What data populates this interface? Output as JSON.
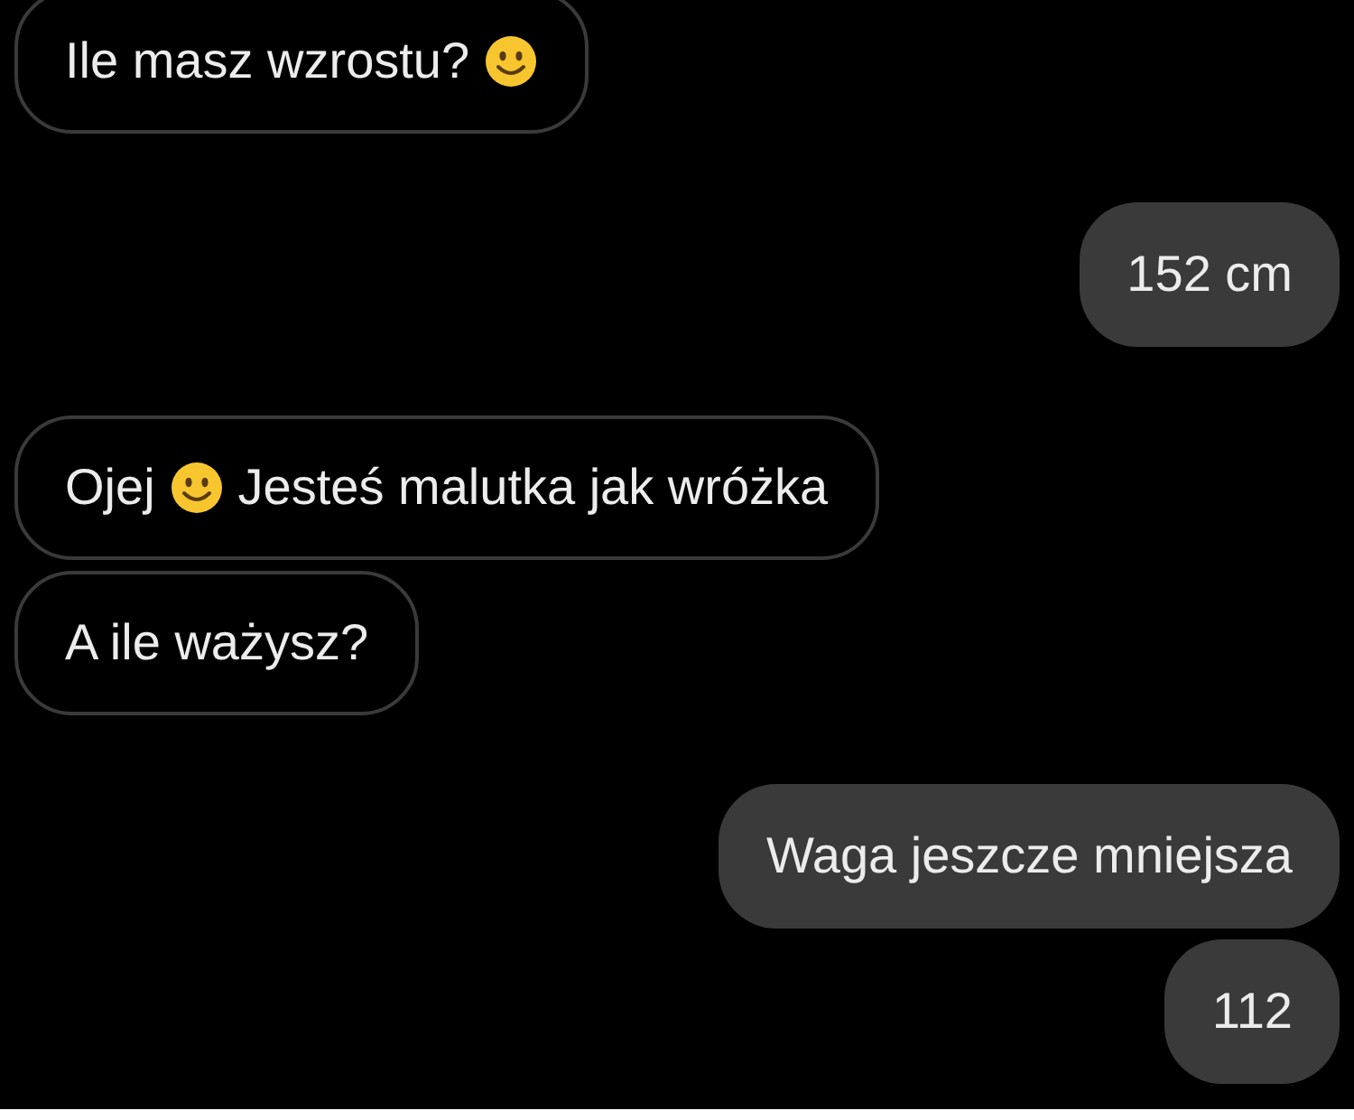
{
  "groups": [
    {
      "kind": "incoming",
      "messages": [
        {
          "parts": [
            {
              "kind": "text",
              "text": "Ile masz wzrostu?"
            },
            {
              "kind": "emoji"
            }
          ]
        }
      ]
    },
    {
      "kind": "outgoing",
      "messages": [
        {
          "parts": [
            {
              "kind": "text",
              "text": "152 cm"
            }
          ]
        }
      ]
    },
    {
      "kind": "incoming",
      "messages": [
        {
          "parts": [
            {
              "kind": "text",
              "text": "Ojej"
            },
            {
              "kind": "emoji"
            },
            {
              "kind": "text",
              "text": "Jesteś malutka jak wróżka"
            }
          ]
        },
        {
          "parts": [
            {
              "kind": "text",
              "text": "A ile ważysz?"
            }
          ]
        }
      ]
    },
    {
      "kind": "outgoing",
      "messages": [
        {
          "parts": [
            {
              "kind": "text",
              "text": "Waga jeszcze mniejsza"
            }
          ]
        },
        {
          "parts": [
            {
              "kind": "text",
              "text": "112"
            }
          ]
        }
      ]
    }
  ]
}
